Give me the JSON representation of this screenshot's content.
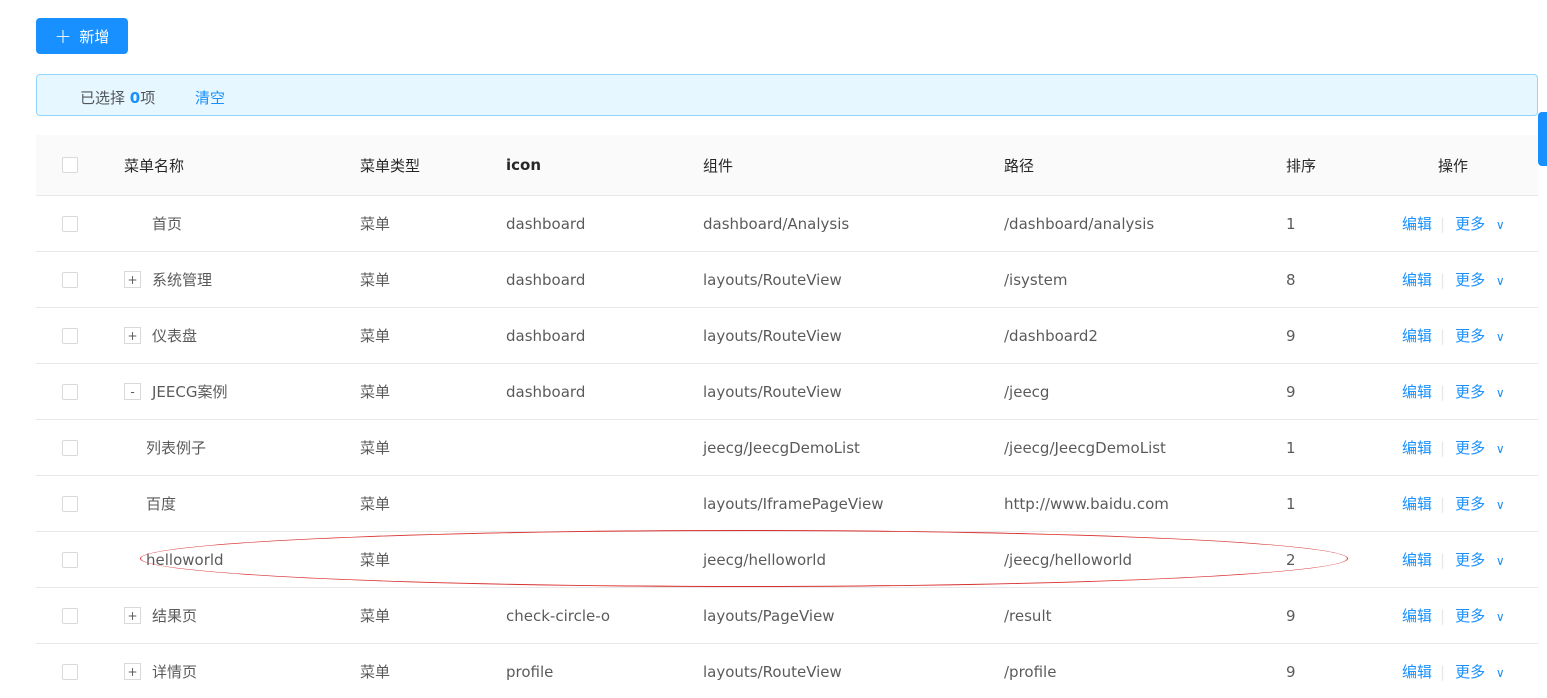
{
  "toolbar": {
    "add_label": "新增"
  },
  "alert": {
    "prefix": "已选择 ",
    "count": "0",
    "suffix": "项",
    "clear_label": "清空"
  },
  "table": {
    "headers": {
      "name": "菜单名称",
      "type": "菜单类型",
      "icon": "icon",
      "component": "组件",
      "path": "路径",
      "sort": "排序",
      "actions": "操作"
    },
    "action_labels": {
      "edit": "编辑",
      "more": "更多"
    },
    "rows": [
      {
        "name": "首页",
        "type": "菜单",
        "icon": "dashboard",
        "component": "dashboard/Analysis",
        "path": "/dashboard/analysis",
        "sort": "1",
        "expander": "",
        "level": 0
      },
      {
        "name": "系统管理",
        "type": "菜单",
        "icon": "dashboard",
        "component": "layouts/RouteView",
        "path": "/isystem",
        "sort": "8",
        "expander": "+",
        "level": 0
      },
      {
        "name": "仪表盘",
        "type": "菜单",
        "icon": "dashboard",
        "component": "layouts/RouteView",
        "path": "/dashboard2",
        "sort": "9",
        "expander": "+",
        "level": 0
      },
      {
        "name": "JEECG案例",
        "type": "菜单",
        "icon": "dashboard",
        "component": "layouts/RouteView",
        "path": "/jeecg",
        "sort": "9",
        "expander": "-",
        "level": 0
      },
      {
        "name": "列表例子",
        "type": "菜单",
        "icon": "",
        "component": "jeecg/JeecgDemoList",
        "path": "/jeecg/JeecgDemoList",
        "sort": "1",
        "expander": "",
        "level": 1
      },
      {
        "name": "百度",
        "type": "菜单",
        "icon": "",
        "component": "layouts/IframePageView",
        "path": "http://www.baidu.com",
        "sort": "1",
        "expander": "",
        "level": 1
      },
      {
        "name": "helloworld",
        "type": "菜单",
        "icon": "",
        "component": "jeecg/helloworld",
        "path": "/jeecg/helloworld",
        "sort": "2",
        "expander": "",
        "level": 1,
        "highlighted": true
      },
      {
        "name": "结果页",
        "type": "菜单",
        "icon": "check-circle-o",
        "component": "layouts/PageView",
        "path": "/result",
        "sort": "9",
        "expander": "+",
        "level": 0
      },
      {
        "name": "详情页",
        "type": "菜单",
        "icon": "profile",
        "component": "layouts/RouteView",
        "path": "/profile",
        "sort": "9",
        "expander": "+",
        "level": 0
      }
    ]
  },
  "colors": {
    "primary": "#1890ff",
    "alert_bg": "#e6f7ff",
    "alert_border": "#91d5ff",
    "highlight_ellipse": "#d93030"
  }
}
